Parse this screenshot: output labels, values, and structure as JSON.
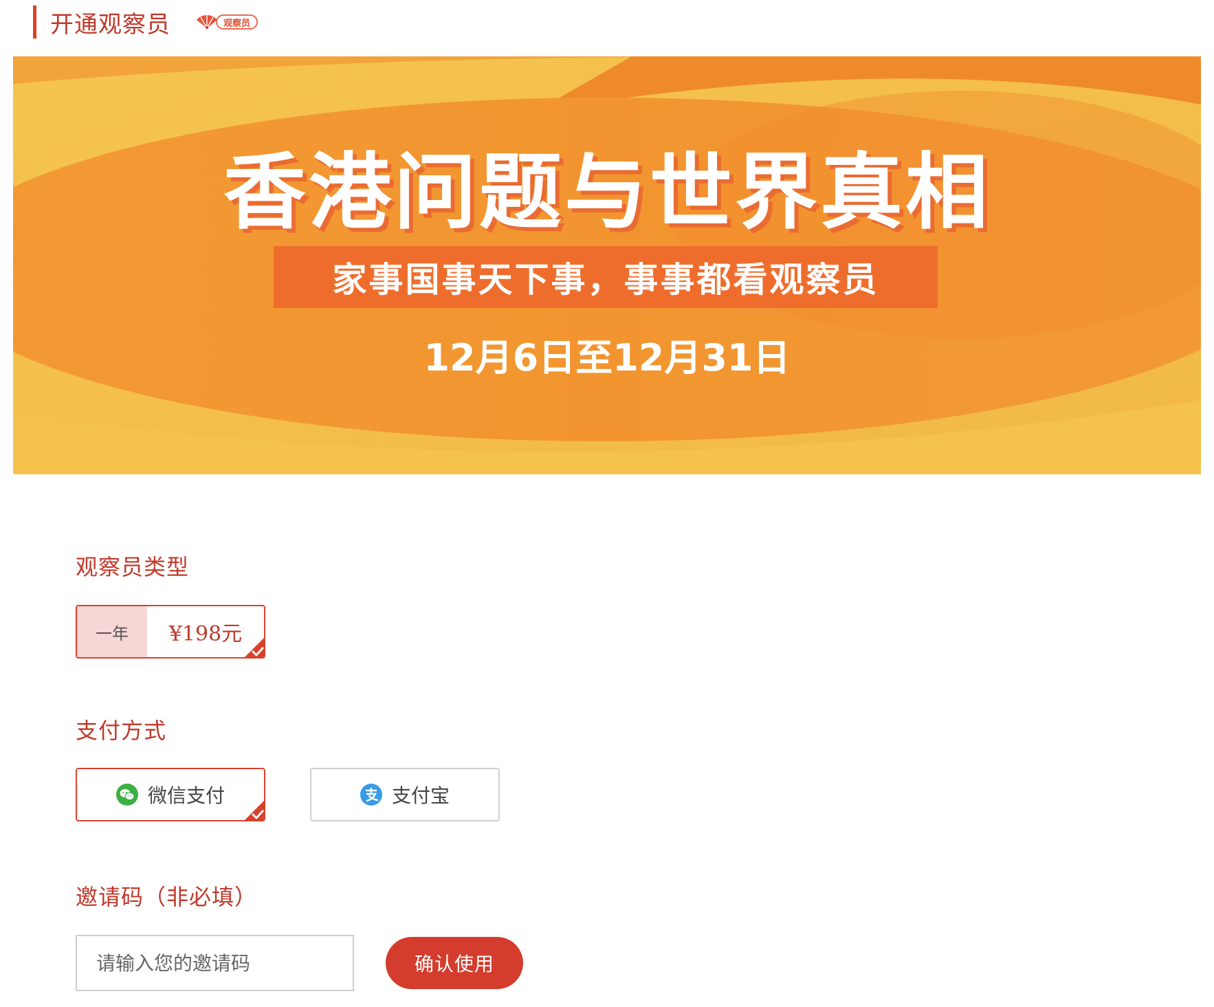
{
  "header": {
    "title": "开通观察员",
    "badge_text": "观察员"
  },
  "banner": {
    "title": "香港问题与世界真相",
    "slogan": "家事国事天下事，事事都看观察员",
    "date_range": "12月6日至12月31日"
  },
  "membership": {
    "label": "观察员类型",
    "plan": {
      "term": "一年",
      "price": "¥198元",
      "selected": true
    }
  },
  "payment": {
    "label": "支付方式",
    "options": [
      {
        "name": "微信支付",
        "icon": "wechat-icon",
        "selected": true
      },
      {
        "name": "支付宝",
        "icon": "alipay-icon",
        "selected": false
      }
    ]
  },
  "invite": {
    "label": "邀请码（非必填）",
    "placeholder": "请输入您的邀请码",
    "value": "",
    "button_label": "确认使用"
  },
  "colors": {
    "accent": "#d9412c",
    "banner_orange": "#ef6d2c",
    "banner_yellow": "#f7c24c",
    "plan_highlight": "#f7d6d6"
  }
}
